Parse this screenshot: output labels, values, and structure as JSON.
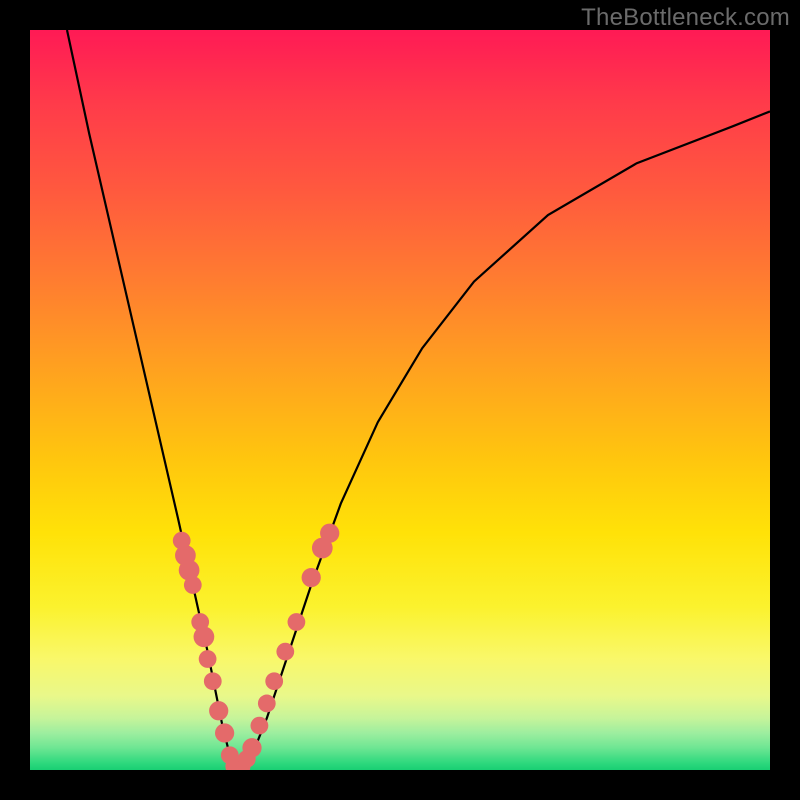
{
  "watermark": "TheBottleneck.com",
  "chart_data": {
    "type": "line",
    "title": "",
    "xlabel": "",
    "ylabel": "",
    "xlim": [
      0,
      100
    ],
    "ylim": [
      0,
      100
    ],
    "grid": false,
    "series": [
      {
        "name": "curve",
        "color": "#000000",
        "x": [
          5,
          8,
          11,
          14,
          17,
          20,
          22,
          24,
          25,
          26,
          27,
          28,
          29,
          30,
          32,
          35,
          38,
          42,
          47,
          53,
          60,
          70,
          82,
          95,
          100
        ],
        "y": [
          100,
          86,
          73,
          60,
          47,
          34,
          25,
          16,
          11,
          6,
          2,
          0,
          0,
          2,
          7,
          16,
          25,
          36,
          47,
          57,
          66,
          75,
          82,
          87,
          89
        ]
      }
    ],
    "markers": [
      {
        "x": 20.5,
        "y": 31,
        "r": 1.2
      },
      {
        "x": 21.0,
        "y": 29,
        "r": 1.4
      },
      {
        "x": 21.5,
        "y": 27,
        "r": 1.4
      },
      {
        "x": 22.0,
        "y": 25,
        "r": 1.2
      },
      {
        "x": 23.0,
        "y": 20,
        "r": 1.2
      },
      {
        "x": 23.5,
        "y": 18,
        "r": 1.4
      },
      {
        "x": 24.0,
        "y": 15,
        "r": 1.2
      },
      {
        "x": 24.7,
        "y": 12,
        "r": 1.2
      },
      {
        "x": 25.5,
        "y": 8,
        "r": 1.3
      },
      {
        "x": 26.3,
        "y": 5,
        "r": 1.3
      },
      {
        "x": 27.0,
        "y": 2,
        "r": 1.2
      },
      {
        "x": 27.7,
        "y": 0.5,
        "r": 1.3
      },
      {
        "x": 28.5,
        "y": 0.5,
        "r": 1.3
      },
      {
        "x": 29.3,
        "y": 1.5,
        "r": 1.2
      },
      {
        "x": 30.0,
        "y": 3,
        "r": 1.3
      },
      {
        "x": 31.0,
        "y": 6,
        "r": 1.2
      },
      {
        "x": 32.0,
        "y": 9,
        "r": 1.2
      },
      {
        "x": 33.0,
        "y": 12,
        "r": 1.2
      },
      {
        "x": 34.5,
        "y": 16,
        "r": 1.2
      },
      {
        "x": 36.0,
        "y": 20,
        "r": 1.2
      },
      {
        "x": 38.0,
        "y": 26,
        "r": 1.3
      },
      {
        "x": 39.5,
        "y": 30,
        "r": 1.4
      },
      {
        "x": 40.5,
        "y": 32,
        "r": 1.3
      }
    ],
    "marker_color": "#e46a6a"
  }
}
